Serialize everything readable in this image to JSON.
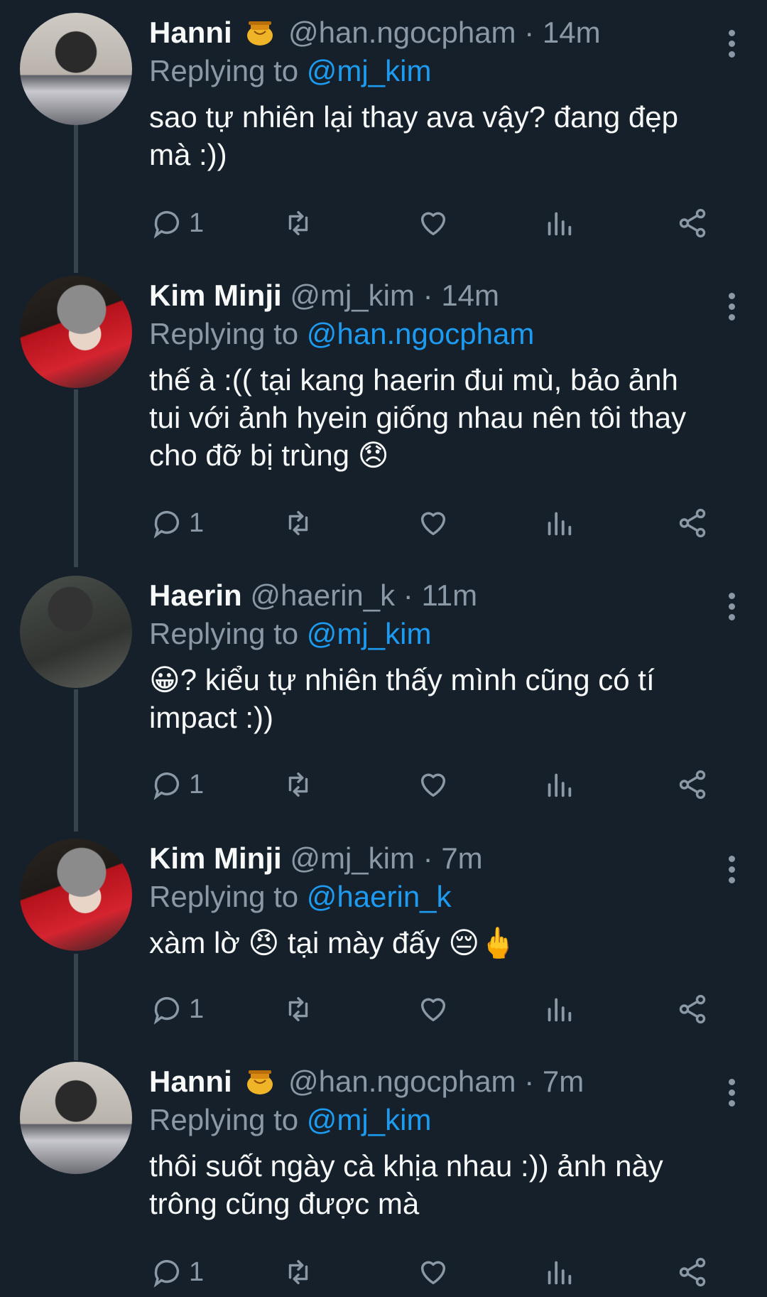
{
  "tweets": [
    {
      "name": "Hanni",
      "has_badge": true,
      "handle": "@han.ngocpham",
      "time": "14m",
      "replying_prefix": "Replying to",
      "replying_to": "@mj_kim",
      "text_lines": [
        "sao tự nhiên lại thay ava vậy? đang đẹp",
        "mà :))"
      ],
      "reply_count": "1"
    },
    {
      "name": "Kim Minji",
      "has_badge": false,
      "handle": "@mj_kim",
      "time": "14m",
      "replying_prefix": "Replying to",
      "replying_to": "@han.ngocpham",
      "text_lines": [
        "thế à :(( tại kang haerin đui mù, bảo ảnh",
        "tui với ảnh hyein giống nhau nên tôi thay",
        "cho đỡ bị trùng 😞"
      ],
      "reply_count": "1"
    },
    {
      "name": "Haerin",
      "has_badge": false,
      "handle": "@haerin_k",
      "time": "11m",
      "replying_prefix": "Replying to",
      "replying_to": "@mj_kim",
      "text_lines": [
        "😀? kiểu tự nhiên thấy mình cũng có tí",
        "impact :))"
      ],
      "reply_count": "1"
    },
    {
      "name": "Kim Minji",
      "has_badge": false,
      "handle": "@mj_kim",
      "time": "7m",
      "replying_prefix": "Replying to",
      "replying_to": "@haerin_k",
      "text_lines": [
        "xàm lờ 😠 tại mày đấy 😔🖕"
      ],
      "reply_count": "1"
    },
    {
      "name": "Hanni",
      "has_badge": true,
      "handle": "@han.ngocpham",
      "time": "7m",
      "replying_prefix": "Replying to",
      "replying_to": "@mj_kim",
      "text_lines": [
        "thôi suốt ngày cà khịa nhau :)) ảnh này",
        "trông cũng được mà"
      ],
      "reply_count": "1"
    }
  ],
  "icons": {
    "reply": "reply-icon",
    "retweet": "retweet-icon",
    "like": "heart-icon",
    "views": "views-icon",
    "share": "share-icon",
    "more": "more-options-icon",
    "badge": "honey-pot-icon"
  },
  "colors": {
    "background": "#15202b",
    "text": "#f7f9f9",
    "muted": "#8b98a5",
    "mention": "#1d9bf0",
    "thread_line": "#38444d"
  }
}
